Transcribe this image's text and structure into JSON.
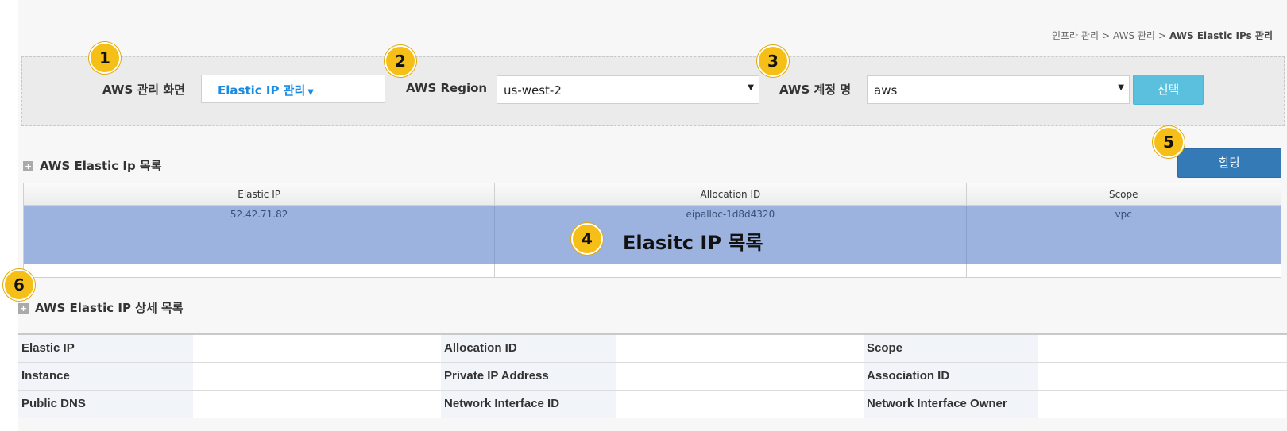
{
  "breadcrumb": {
    "part1": "인프라 관리",
    "part2": "AWS 관리",
    "current": "AWS Elastic IPs 관리",
    "separator": ">"
  },
  "filter": {
    "mgmt_label": "AWS 관리 화면",
    "mgmt_value": "Elastic IP 관리",
    "region_label": "AWS Region",
    "region_value": "us-west-2",
    "account_label": "AWS 계정 명",
    "account_value": "aws",
    "select_button": "선택"
  },
  "list_section": {
    "title": "AWS Elastic Ip 목록",
    "assign_button": "할당",
    "columns": [
      "Elastic IP",
      "Allocation ID",
      "Scope"
    ],
    "rows": [
      [
        "52.42.71.82",
        "eipalloc-1d8d4320",
        "vpc"
      ]
    ]
  },
  "detail_section": {
    "title": "AWS Elastic IP 상세 목록",
    "fields": [
      [
        "Elastic IP",
        "Allocation ID",
        "Scope"
      ],
      [
        "Instance",
        "Private IP Address",
        "Association ID"
      ],
      [
        "Public DNS",
        "Network Interface ID",
        "Network Interface Owner"
      ]
    ]
  },
  "annotations": {
    "badges": [
      "1",
      "2",
      "3",
      "4",
      "5",
      "6"
    ],
    "list_label": "Elasitc IP 목록"
  },
  "colors": {
    "badge": "#f5bf18",
    "select_button": "#5bc0de",
    "assign_button": "#337ab7",
    "selected_row": "#9db3df",
    "accent_link": "#1a8be0"
  }
}
